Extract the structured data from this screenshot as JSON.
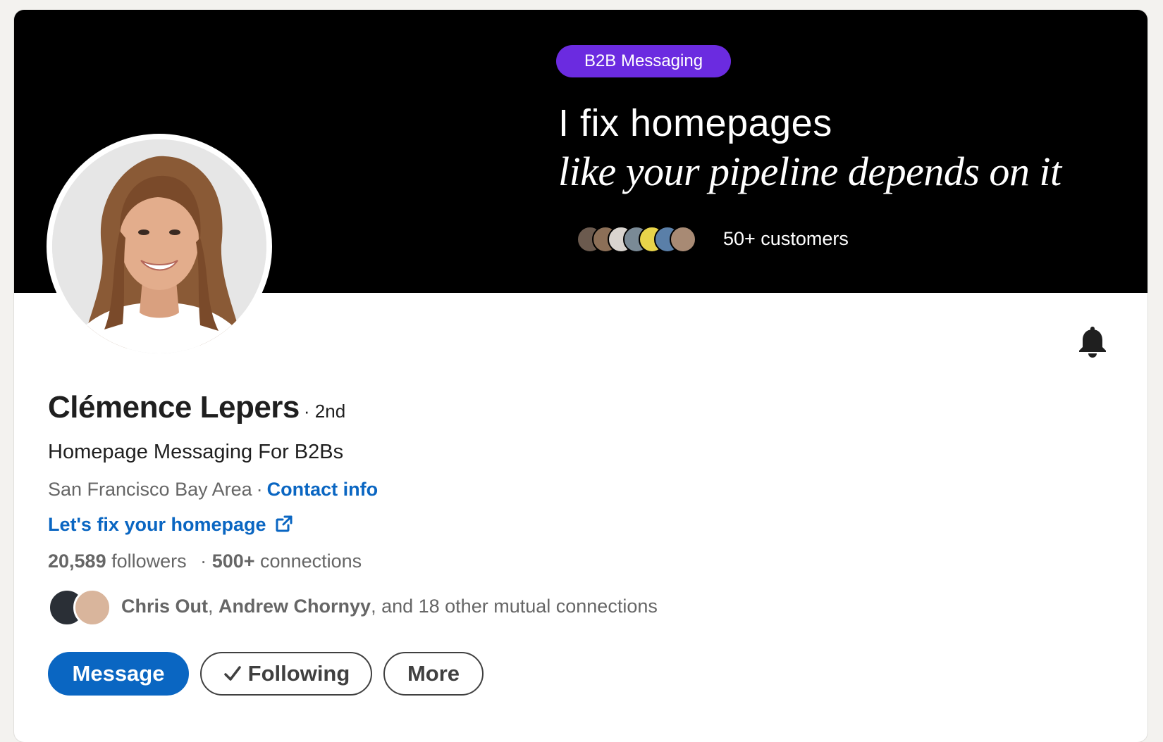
{
  "colors": {
    "brand_blue": "#0a66c2",
    "banner_bg": "#000000",
    "tag_purple": "#6b2be0",
    "text_primary": "#1f1f1f",
    "text_secondary": "#666666"
  },
  "banner": {
    "tag": "B2B Messaging",
    "line1": "I fix homepages",
    "line2": "like your pipeline depends on it",
    "customers": "50+ customers"
  },
  "actions": {
    "bell_icon": "bell-icon"
  },
  "profile": {
    "name": "Clémence Lepers",
    "degree": "· 2nd",
    "headline": "Homepage Messaging For B2Bs",
    "location": "San Francisco Bay Area",
    "separator": "·",
    "contact_info": "Contact info",
    "website_label": "Let's fix your homepage",
    "followers_count": "20,589",
    "followers_label": "followers",
    "stats_separator": "·",
    "connections_count": "500+",
    "connections_label": "connections",
    "mutual": {
      "name1": "Chris Out",
      "comma1": ",",
      "name2": "Andrew Chornyy",
      "rest": ", and 18 other mutual connections"
    }
  },
  "buttons": {
    "message": "Message",
    "following": "Following",
    "more": "More"
  }
}
